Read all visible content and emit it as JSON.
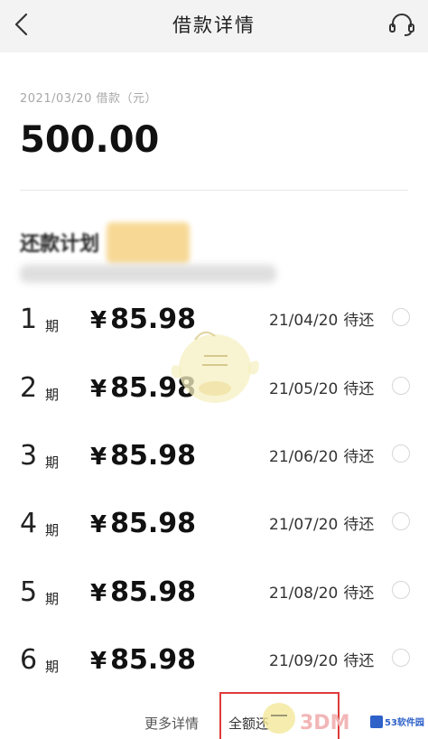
{
  "header": {
    "title": "借款详情",
    "back_icon": "back-arrow-icon",
    "support_icon": "headset-icon"
  },
  "loan": {
    "meta": "2021/03/20 借款（元）",
    "amount": "500.00"
  },
  "plan": {
    "heading": "还款计划"
  },
  "installments": [
    {
      "num": "1",
      "unit": "期",
      "currency": "¥",
      "amount": "85.98",
      "date": "21/04/20",
      "status": "待还"
    },
    {
      "num": "2",
      "unit": "期",
      "currency": "¥",
      "amount": "85.98",
      "date": "21/05/20",
      "status": "待还"
    },
    {
      "num": "3",
      "unit": "期",
      "currency": "¥",
      "amount": "85.98",
      "date": "21/06/20",
      "status": "待还"
    },
    {
      "num": "4",
      "unit": "期",
      "currency": "¥",
      "amount": "85.98",
      "date": "21/07/20",
      "status": "待还"
    },
    {
      "num": "5",
      "unit": "期",
      "currency": "¥",
      "amount": "85.98",
      "date": "21/08/20",
      "status": "待还"
    },
    {
      "num": "6",
      "unit": "期",
      "currency": "¥",
      "amount": "85.98",
      "date": "21/09/20",
      "status": "待还"
    }
  ],
  "footer": {
    "more_details": "更多详情",
    "repay_label": "全额还"
  },
  "watermarks": {
    "brand": "3DM",
    "site_logo": "53软件园"
  },
  "colors": {
    "header_bg": "#f3f3f3",
    "highlight_border": "#e03a3a"
  }
}
